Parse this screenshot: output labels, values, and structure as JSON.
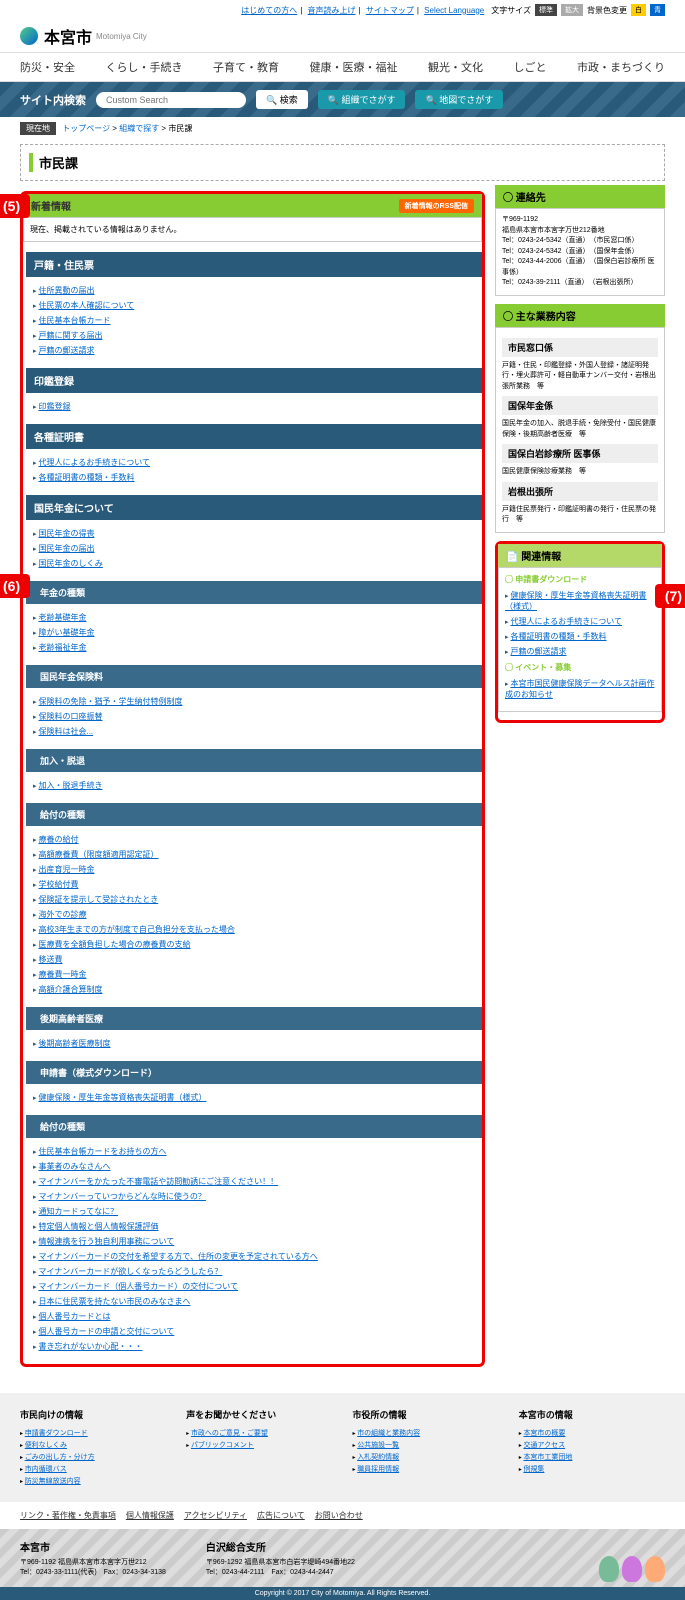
{
  "top": {
    "links": [
      "はじめての方へ",
      "音声読み上げ",
      "サイトマップ",
      "Select Language"
    ],
    "fontsize": "文字サイズ",
    "std": "標準",
    "big": "拡大",
    "bgcolor": "背景色変更",
    "white": "白",
    "blue": "青"
  },
  "site": {
    "name": "本宮市",
    "sub": "Motomiya City"
  },
  "nav": [
    "防災・安全",
    "くらし・手続き",
    "子育て・教育",
    "健康・医療・福祉",
    "観光・文化",
    "しごと",
    "市政・まちづくり"
  ],
  "search": {
    "label": "サイト内検索",
    "placeholder": "Custom Search",
    "btn": "検索",
    "org": "組織でさがす",
    "map": "地図でさがす"
  },
  "crumb": {
    "badge": "現在地",
    "path": [
      "トップページ",
      "組織で探す",
      "市民課"
    ]
  },
  "title": "市民課",
  "news": {
    "head": "新着情報",
    "rss": "新着情報のRSS配信",
    "empty": "現在、掲載されている情報はありません。"
  },
  "cats": [
    {
      "h": "戸籍・住民票",
      "items": [
        "住所異動の届出",
        "住民票の本人確認について",
        "住民基本台帳カード",
        "戸籍に関する届出",
        "戸籍の郵送請求"
      ]
    },
    {
      "h": "印鑑登録",
      "items": [
        "印鑑登録"
      ]
    },
    {
      "h": "各種証明書",
      "items": [
        "代理人によるお手続きについて",
        "各種証明書の種類・手数料"
      ]
    },
    {
      "h": "国民年金について",
      "items": [
        "国民年金の得喪",
        "国民年金の届出",
        "国民年金のしくみ"
      ],
      "subs": [
        {
          "h": "年金の種類",
          "items": [
            "老齢基礎年金",
            "障がい基礎年金",
            "老齢福祉年金"
          ]
        },
        {
          "h": "国民年金保険料",
          "items": [
            "保険料の免除・猶予・学生納付特例制度",
            "保険料の口座振替",
            "保険料は社会..."
          ]
        },
        {
          "h": "加入・脱退",
          "items": [
            "加入・脱退手続き"
          ]
        },
        {
          "h": "給付の種類",
          "items": [
            "療養の給付",
            "高額療養費（限度額適用認定証）",
            "出産育児一時金",
            "学校給付費",
            "保険証を提示して受診されたとき",
            "海外での診療",
            "高校3年生までの方が制度で自己負担分を支払った場合",
            "医療費を全額負担した場合の療養費の支給",
            "移送費",
            "療養費一時金",
            "高額介護合算制度"
          ]
        },
        {
          "h": "後期高齢者医療",
          "items": [
            "後期高齢者医療制度"
          ]
        },
        {
          "h": "申請書（様式ダウンロード）",
          "items": [
            "健康保険・厚生年金等資格喪失証明書（様式）"
          ]
        },
        {
          "h": "給付の種類",
          "items": [
            "住民基本台帳カードをお持ちの方へ",
            "事業者のみなさんへ",
            "マイナンバーをかたった不審電話や訪問勧誘にご注意ください！！",
            "マイナンバーっていつからどんな時に使うの？",
            "通知カードってなに？",
            "特定個人情報と個人情報保護評価",
            "情報連携を行う独自利用事務について",
            "マイナンバーカードの交付を希望する方で、住所の変更を予定されている方へ",
            "マイナンバーカードが欲しくなったらどうしたら？",
            "マイナンバーカード（個人番号カード）の交付について",
            "日本に住民票を持たない市民のみなさまへ",
            "個人番号カードとは",
            "個人番号カードの申請と交付について",
            "書き忘れがないか心配・・・"
          ]
        }
      ]
    }
  ],
  "side": {
    "contact": {
      "head": "連絡先",
      "zip": "〒969-1192",
      "addr": "福島県本宮市本宮字万世212番地",
      "tels": [
        "Tel：0243-24-5342（直通）　（市民窓口係）",
        "Tel：0243-24-5342（直通）　（国保年金係）",
        "Tel：0243-44-2006（直通）　（国保白岩診療所 医事係）",
        "Tel：0243-39-2111（直通）　（岩根出張所）"
      ]
    },
    "biz": {
      "head": "主な業務内容",
      "rows": [
        {
          "h": "市民窓口係",
          "t": "戸籍・住民・印鑑登録・外国人登録・諸証明発行・埋火葬許可・軽自動車ナンバー交付・岩根出張所業務　等"
        },
        {
          "h": "国保年金係",
          "t": "国民年金の加入、脱退手続・免除受付・国民健康保険・後期高齢者医療　等"
        },
        {
          "h": "国保白岩診療所 医事係",
          "t": "国民健康保険診療業務　等"
        },
        {
          "h": "岩根出張所",
          "t": "戸籍住民票発行・印鑑証明書の発行・住民票の発行　等"
        }
      ]
    },
    "rel": {
      "head": "関連情報",
      "dl": {
        "h": "申請書ダウンロード",
        "items": [
          "健康保険・厚生年金等資格喪失証明書（様式）",
          "代理人によるお手続きについて",
          "各種証明書の種類・手数料",
          "戸籍の郵送請求"
        ]
      },
      "ev": {
        "h": "イベント・募集",
        "items": [
          "本宮市国民健康保険データヘルス計画作成のお知らせ"
        ]
      }
    }
  },
  "footer": {
    "cols": [
      {
        "h": "市民向けの情報",
        "items": [
          "申請書ダウンロード",
          "便利なしくみ",
          "ごみの出し方・分け方",
          "市内循環バス",
          "防災無線放送内容"
        ]
      },
      {
        "h": "声をお聞かせください",
        "items": [
          "市政へのご意見・ご要望",
          "パブリックコメント"
        ]
      },
      {
        "h": "市役所の情報",
        "items": [
          "市の組織と業務内容",
          "公共施設一覧",
          "入札契約情報",
          "職員採用情報"
        ]
      },
      {
        "h": "本宮市の情報",
        "items": [
          "本宮市の概要",
          "交通アクセス",
          "本宮市工業団地",
          "例規集"
        ]
      }
    ],
    "links": [
      "リンク・著作権・免責事項",
      "個人情報保護",
      "アクセシビリティ",
      "広告について",
      "お問い合わせ"
    ],
    "b1": {
      "h": "本宮市",
      "a": "〒969-1192 福島県本宮市本宮字万世212",
      "t": "Tel：0243-33-1111(代表)　Fax：0243-34-3138"
    },
    "b2": {
      "h": "白沢総合支所",
      "a": "〒969-1292 福島県本宮市白岩字堤崎494番地22",
      "t": "Tel：0243-44-2111　Fax：0243-44-2447"
    },
    "cp": "Copyright © 2017 City of Motomiya. All Rights Reserved."
  }
}
